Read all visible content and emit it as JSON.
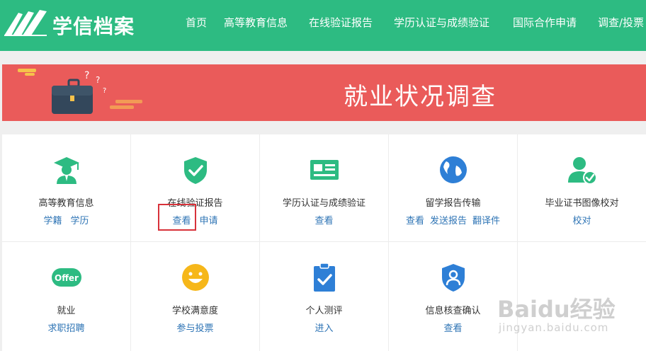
{
  "header": {
    "logo_text": "学信档案",
    "nav": [
      "首页",
      "高等教育信息",
      "在线验证报告",
      "学历认证与成绩验证",
      "国际合作申请",
      "调查/投票"
    ]
  },
  "banner": {
    "title": "就业状况调查"
  },
  "cells": [
    {
      "title": "高等教育信息",
      "links": [
        "学籍",
        "学历"
      ],
      "icon": "graduate-icon"
    },
    {
      "title": "在线验证报告",
      "links": [
        "查看",
        "申请"
      ],
      "icon": "shield-check-icon"
    },
    {
      "title": "学历认证与成绩验证",
      "links": [
        "查看"
      ],
      "icon": "id-card-icon"
    },
    {
      "title": "留学报告传输",
      "links": [
        "查看",
        "发送报告",
        "翻译件"
      ],
      "icon": "globe-icon"
    },
    {
      "title": "毕业证书图像校对",
      "links": [
        "校对"
      ],
      "icon": "user-check-icon"
    },
    {
      "title": "就业",
      "links": [
        "求职招聘"
      ],
      "icon": "offer-icon"
    },
    {
      "title": "学校满意度",
      "links": [
        "参与投票"
      ],
      "icon": "smiley-icon"
    },
    {
      "title": "个人测评",
      "links": [
        "进入"
      ],
      "icon": "clipboard-check-icon"
    },
    {
      "title": "信息核查确认",
      "links": [
        "查看"
      ],
      "icon": "user-shield-icon"
    }
  ],
  "offer_badge": "Offer",
  "watermark": {
    "main": "Baidu经验",
    "sub": "jingyan.baidu.com"
  },
  "colors": {
    "header": "#2dbb82",
    "banner": "#ea5b5a",
    "icon": "#2dbb82",
    "link": "#2e74b5",
    "highlight": "#d8323a"
  }
}
